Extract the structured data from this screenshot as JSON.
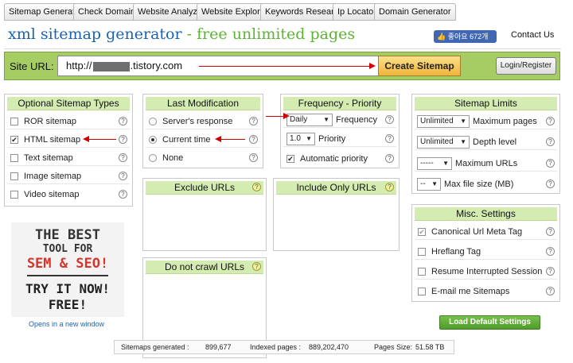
{
  "tabs": [
    "Sitemap Generator",
    "Check Domains",
    "Website Analyzer",
    "Website Explorer",
    "Keywords Research",
    "Ip Locator",
    "Domain Generator"
  ],
  "header": {
    "title_main": "xml sitemap generator",
    "title_sep": " - ",
    "title_sub": "free unlimited pages",
    "fb_like": "좋아요 672개",
    "contact": "Contact Us"
  },
  "urlbar": {
    "label": "Site URL:",
    "url_prefix": "http://",
    "url_suffix": ".tistory.com",
    "create_button": "Create Sitemap",
    "login_button": "Login/Register"
  },
  "sitemap_types": {
    "title": "Optional Sitemap Types",
    "items": [
      {
        "label": "ROR sitemap",
        "checked": false
      },
      {
        "label": "HTML sitemap",
        "checked": true
      },
      {
        "label": "Text sitemap",
        "checked": false
      },
      {
        "label": "Image sitemap",
        "checked": false
      },
      {
        "label": "Video sitemap",
        "checked": false
      }
    ]
  },
  "last_modification": {
    "title": "Last Modification",
    "items": [
      {
        "label": "Server's response",
        "selected": false
      },
      {
        "label": "Current time",
        "selected": true
      },
      {
        "label": "None",
        "selected": false
      }
    ]
  },
  "frequency_priority": {
    "title": "Frequency - Priority",
    "frequency_value": "Daily",
    "frequency_label": "Frequency",
    "priority_value": "1.0",
    "priority_label": "Priority",
    "auto_priority_label": "Automatic priority",
    "auto_priority_checked": true
  },
  "sitemap_limits": {
    "title": "Sitemap Limits",
    "items": [
      {
        "value": "Unlimited",
        "label": "Maximum pages"
      },
      {
        "value": "Unlimited",
        "label": "Depth level"
      },
      {
        "value": "-----",
        "label": "Maximum URLs"
      },
      {
        "value": "--",
        "label": "Max file size (MB)"
      }
    ]
  },
  "exclude": {
    "title": "Exclude URLs"
  },
  "include_only": {
    "title": "Include Only URLs"
  },
  "no_crawl": {
    "title": "Do not crawl URLs"
  },
  "misc": {
    "title": "Misc. Settings",
    "items": [
      {
        "label": "Canonical Url Meta Tag",
        "checked": true
      },
      {
        "label": "Hreflang Tag",
        "checked": false
      },
      {
        "label": "Resume Interrupted Session",
        "checked": false
      },
      {
        "label": "E-mail me Sitemaps",
        "checked": false
      }
    ]
  },
  "ad": {
    "line1": "THE BEST",
    "line2": "TOOL FOR",
    "line3": "SEM & SEO!",
    "line4": "TRY IT NOW!",
    "line5": "FREE!",
    "opens_note": "Opens in a new window"
  },
  "default_button": "Load Default Settings",
  "stats": {
    "generated_label": "Sitemaps generated :",
    "generated_value": "899,677",
    "indexed_label": "Indexed pages :",
    "indexed_value": "889,202,470",
    "size_label": "Pages Size:",
    "size_value": "51.58 TB"
  },
  "colors": {
    "accent_blue": "#1b63b0",
    "accent_green": "#5db334",
    "url_bar": "#a5cd63",
    "panel_header": "#d4ecb2",
    "annotation_arrow": "#d40000"
  }
}
